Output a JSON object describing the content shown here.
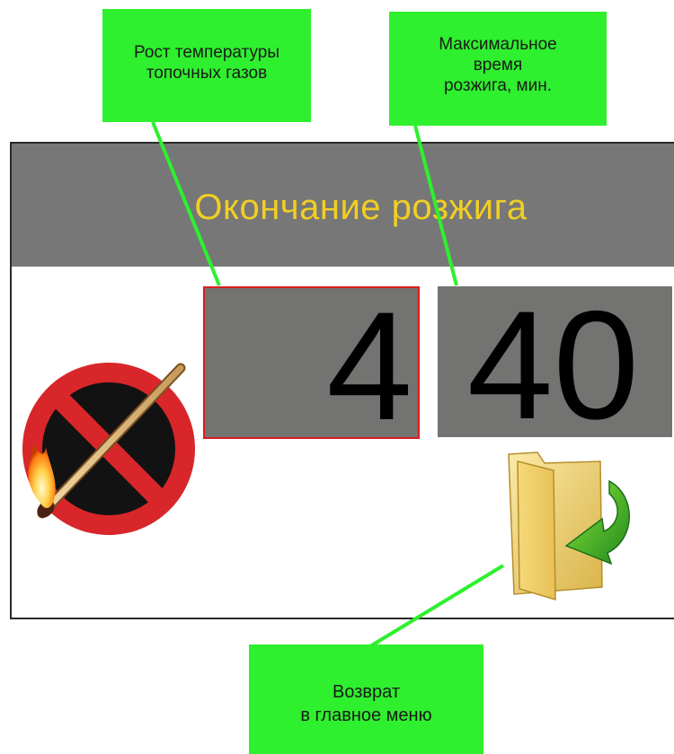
{
  "callouts": {
    "temp_rise": "Рост температуры\nтопочных газов",
    "max_time": "Максимальное\nвремя\nрозжига, мин.",
    "back": "Возврат\nв главное меню"
  },
  "screen": {
    "title": "Окончание розжига",
    "temp_rise_value": "4",
    "max_time_value": "40"
  },
  "icons": {
    "no_ignition": "no-match-icon",
    "return": "folder-return-icon"
  },
  "colors": {
    "callout_bg": "#2ef02e",
    "title_bar": "#767776",
    "title_text": "#f2ce24",
    "value_box": "#737372",
    "highlight_border": "#d91c1c"
  }
}
